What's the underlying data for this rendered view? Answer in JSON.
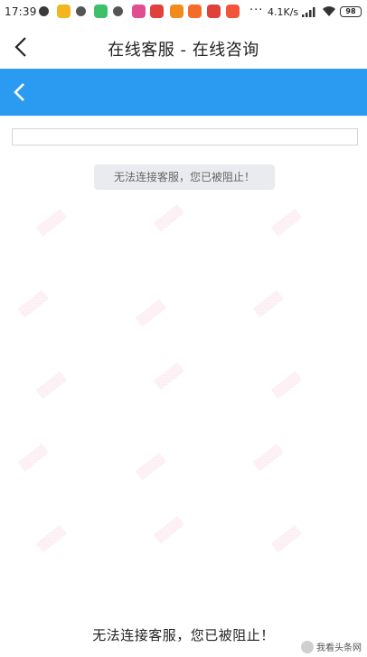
{
  "status_bar": {
    "time": "17:39",
    "net_speed": "4.1K/s",
    "more": "···",
    "battery": "98",
    "notification_icons": [
      {
        "name": "shield-icon",
        "color": "#3a3a3a"
      },
      {
        "name": "app-icon-yellow",
        "color": "#f2b51d"
      },
      {
        "name": "chat-icon",
        "color": "#555555"
      },
      {
        "name": "app-icon-green",
        "color": "#3cc06a"
      },
      {
        "name": "cloud-icon",
        "color": "#555555"
      },
      {
        "name": "app-icon-pink",
        "color": "#e04e8f"
      },
      {
        "name": "app-icon-red",
        "color": "#e0413a"
      },
      {
        "name": "app-icon-orange",
        "color": "#f28b1d"
      },
      {
        "name": "taobao-icon",
        "color": "#f56b2a"
      },
      {
        "name": "app-icon-red2",
        "color": "#e0413a"
      },
      {
        "name": "app-icon-listen",
        "color": "#f2553a"
      }
    ]
  },
  "titlebar": {
    "title": "在线客服 - 在线咨询"
  },
  "content": {
    "toast": "无法连接客服，您已被阻止！"
  },
  "caption": {
    "text": "无法连接客服，您已被阻止！",
    "brand": "我看头条网"
  },
  "colors": {
    "accent_blue": "#2a9bf1"
  }
}
